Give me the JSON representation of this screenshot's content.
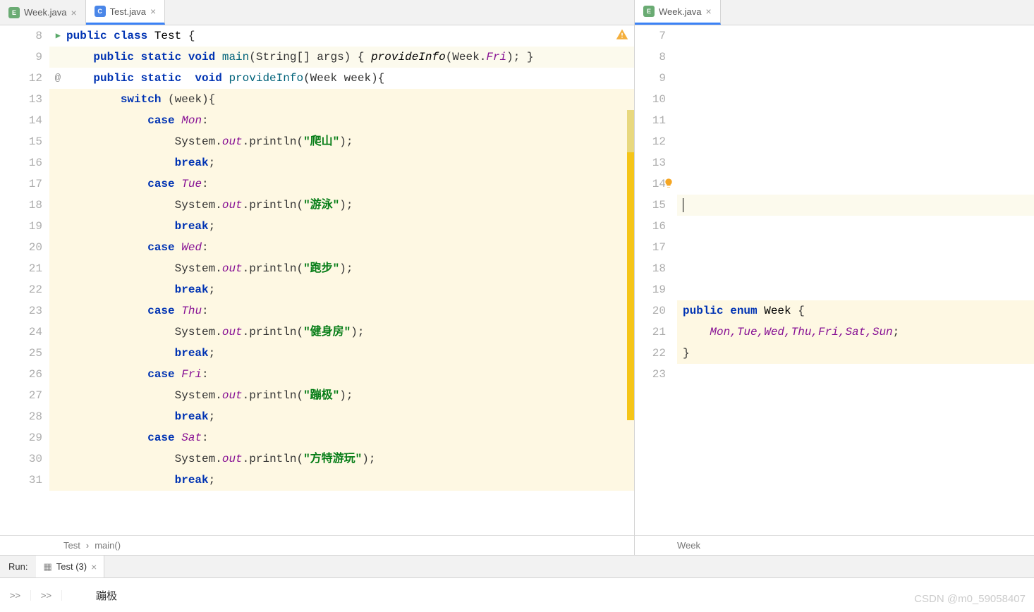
{
  "leftTabs": [
    {
      "icon": "E",
      "iconClass": "e",
      "label": "Week.java",
      "active": false
    },
    {
      "icon": "C",
      "iconClass": "c",
      "label": "Test.java",
      "active": true
    }
  ],
  "rightTabs": [
    {
      "icon": "E",
      "iconClass": "e",
      "label": "Week.java",
      "active": true
    }
  ],
  "leftGutter": [
    "8",
    "9",
    "12",
    "13",
    "14",
    "15",
    "16",
    "17",
    "18",
    "19",
    "20",
    "21",
    "22",
    "23",
    "24",
    "25",
    "26",
    "27",
    "28",
    "29",
    "30",
    "31",
    ""
  ],
  "rightGutter": [
    "7",
    "8",
    "9",
    "10",
    "11",
    "12",
    "13",
    "14",
    "15",
    "16",
    "17",
    "18",
    "19",
    "20",
    "21",
    "22",
    "23"
  ],
  "breadcrumbLeft": {
    "a": "Test",
    "b": "main()"
  },
  "breadcrumbRight": "Week",
  "runLabel": "Run:",
  "runTab": "Test (3)",
  "runControls": ">>",
  "output": "蹦极",
  "watermark": "CSDN @m0_59058407",
  "code": {
    "classDecl": {
      "kw1": "public class ",
      "name": "Test",
      "brace": " {"
    },
    "main": {
      "kw": "public static void ",
      "name": "main",
      "sig": "(String[] args) { ",
      "call": "provideInfo",
      "arg1": "(Week.",
      "fri": "Fri",
      "arg2": "); }"
    },
    "provide": {
      "kw": "public static  void ",
      "name": "provideInfo",
      "sig": "(Week week){"
    },
    "switch": {
      "kw": "switch ",
      "rest": "(week){"
    },
    "cases": [
      {
        "kw": "case ",
        "val": "Mon",
        "colon": ":"
      },
      {
        "pre": "System.",
        "out": "out",
        "mid": ".println(",
        "str": "\"爬山\"",
        "post": ");"
      },
      {
        "kw": "break",
        "semi": ";"
      },
      {
        "kw": "case ",
        "val": "Tue",
        "colon": ":"
      },
      {
        "pre": "System.",
        "out": "out",
        "mid": ".println(",
        "str": "\"游泳\"",
        "post": ");"
      },
      {
        "kw": "break",
        "semi": ";"
      },
      {
        "kw": "case ",
        "val": "Wed",
        "colon": ":"
      },
      {
        "pre": "System.",
        "out": "out",
        "mid": ".println(",
        "str": "\"跑步\"",
        "post": ");"
      },
      {
        "kw": "break",
        "semi": ";"
      },
      {
        "kw": "case ",
        "val": "Thu",
        "colon": ":"
      },
      {
        "pre": "System.",
        "out": "out",
        "mid": ".println(",
        "str": "\"健身房\"",
        "post": ");"
      },
      {
        "kw": "break",
        "semi": ";"
      },
      {
        "kw": "case ",
        "val": "Fri",
        "colon": ":"
      },
      {
        "pre": "System.",
        "out": "out",
        "mid": ".println(",
        "str": "\"蹦极\"",
        "post": ");"
      },
      {
        "kw": "break",
        "semi": ";"
      },
      {
        "kw": "case ",
        "val": "Sat",
        "colon": ":"
      },
      {
        "pre": "System.",
        "out": "out",
        "mid": ".println(",
        "str": "\"方特游玩\"",
        "post": ");"
      },
      {
        "kw": "break",
        "semi": ";"
      }
    ]
  },
  "rightCode": {
    "decl": {
      "kw": "public enum ",
      "name": "Week",
      "brace": " {"
    },
    "vals": "Mon,Tue,Wed,Thu,Fri,Sat,Sun",
    "semi": ";",
    "close": "}"
  }
}
